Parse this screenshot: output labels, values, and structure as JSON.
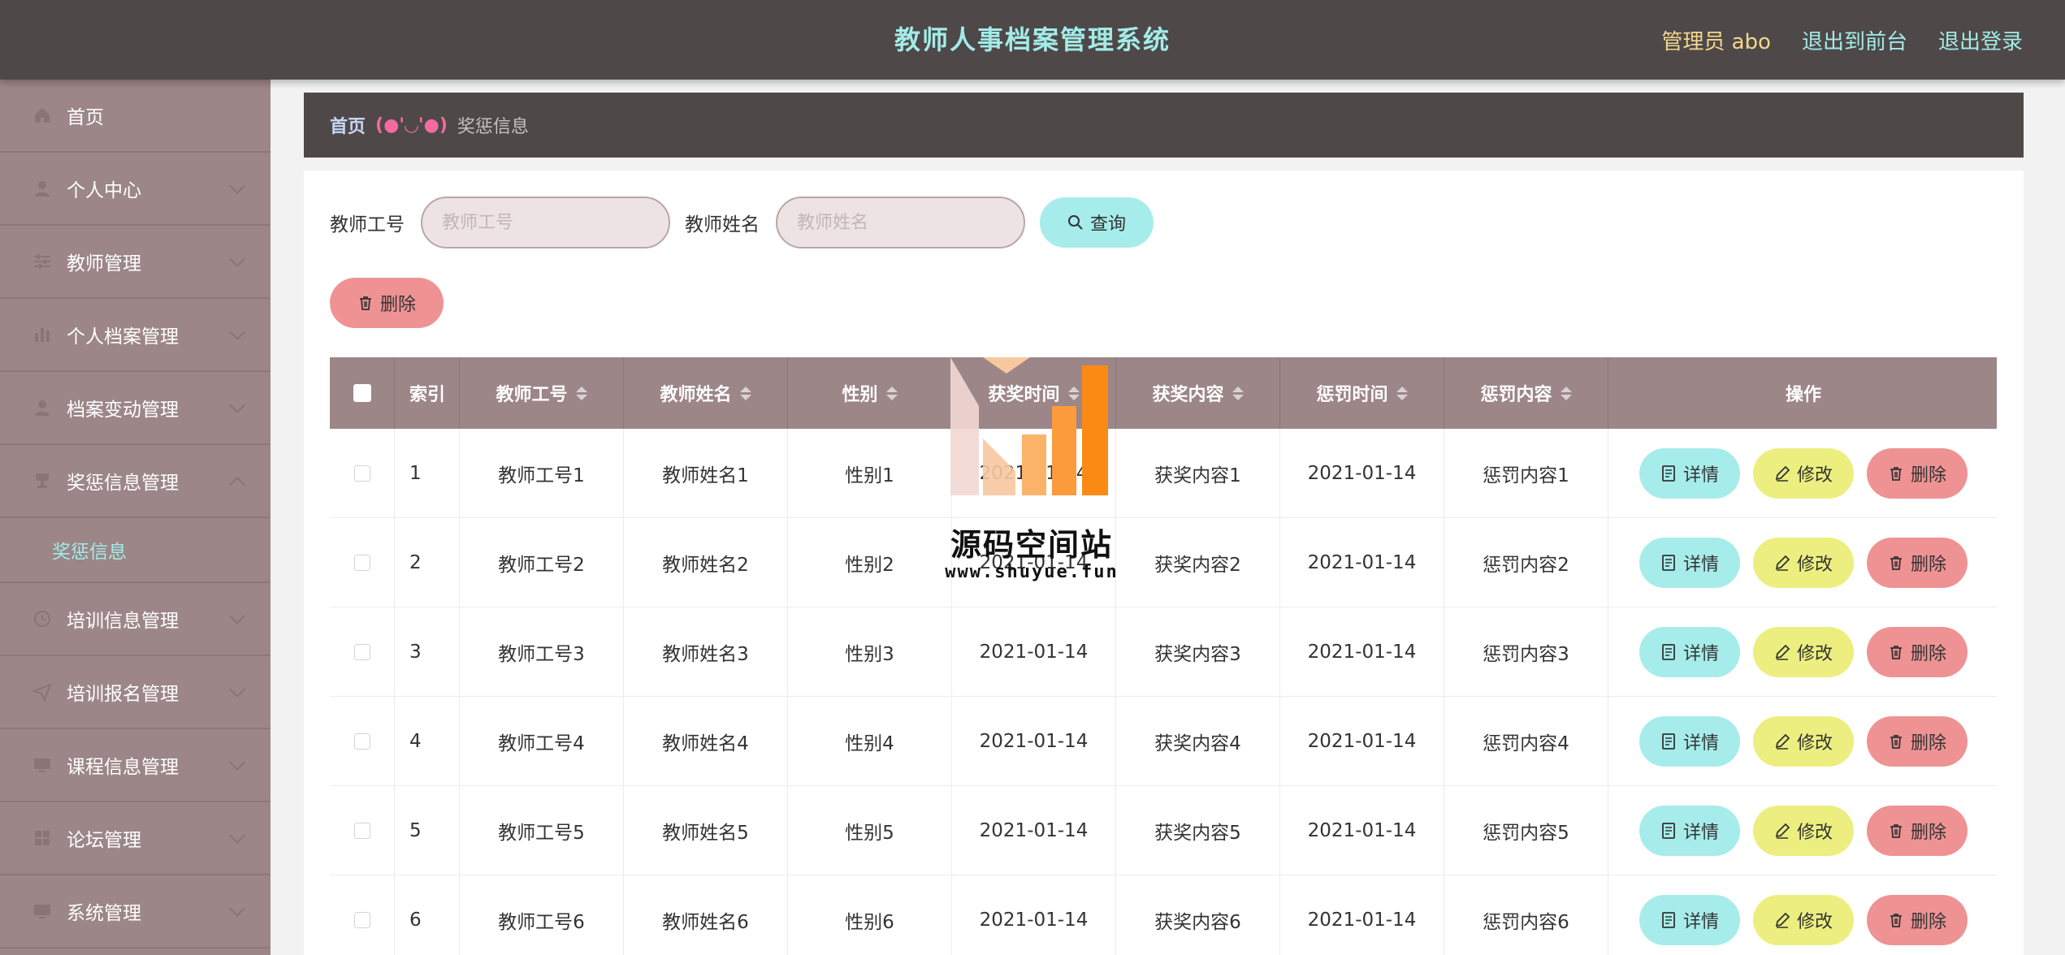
{
  "header": {
    "title": "教师人事档案管理系统",
    "admin_label": "管理员 abo",
    "front_link": "退出到前台",
    "logout_link": "退出登录"
  },
  "sidebar": {
    "items": [
      {
        "label": "首页",
        "icon": "home-icon"
      },
      {
        "label": "个人中心",
        "icon": "user-icon"
      },
      {
        "label": "教师管理",
        "icon": "sliders-icon"
      },
      {
        "label": "个人档案管理",
        "icon": "bar-chart-icon"
      },
      {
        "label": "档案变动管理",
        "icon": "user-icon"
      },
      {
        "label": "奖惩信息管理",
        "icon": "trophy-icon"
      },
      {
        "label": "培训信息管理",
        "icon": "clock-icon"
      },
      {
        "label": "培训报名管理",
        "icon": "send-icon"
      },
      {
        "label": "课程信息管理",
        "icon": "monitor-icon"
      },
      {
        "label": "论坛管理",
        "icon": "grid-icon"
      },
      {
        "label": "系统管理",
        "icon": "monitor-icon"
      }
    ],
    "sub_item": "奖惩信息"
  },
  "breadcrumb": {
    "home": "首页",
    "separator": "(●'◡'●)",
    "current": "奖惩信息"
  },
  "search": {
    "id_label": "教师工号",
    "id_placeholder": "教师工号",
    "name_label": "教师姓名",
    "name_placeholder": "教师姓名",
    "query_label": "查询"
  },
  "toolbar": {
    "delete_label": "删除"
  },
  "table": {
    "headers": [
      "索引",
      "教师工号",
      "教师姓名",
      "性别",
      "获奖时间",
      "获奖内容",
      "惩罚时间",
      "惩罚内容",
      "操作"
    ],
    "rows": [
      [
        "1",
        "教师工号1",
        "教师姓名1",
        "性别1",
        "2021-01-14",
        "获奖内容1",
        "2021-01-14",
        "惩罚内容1"
      ],
      [
        "2",
        "教师工号2",
        "教师姓名2",
        "性别2",
        "2021-01-14",
        "获奖内容2",
        "2021-01-14",
        "惩罚内容2"
      ],
      [
        "3",
        "教师工号3",
        "教师姓名3",
        "性别3",
        "2021-01-14",
        "获奖内容3",
        "2021-01-14",
        "惩罚内容3"
      ],
      [
        "4",
        "教师工号4",
        "教师姓名4",
        "性别4",
        "2021-01-14",
        "获奖内容4",
        "2021-01-14",
        "惩罚内容4"
      ],
      [
        "5",
        "教师工号5",
        "教师姓名5",
        "性别5",
        "2021-01-14",
        "获奖内容5",
        "2021-01-14",
        "惩罚内容5"
      ],
      [
        "6",
        "教师工号6",
        "教师姓名6",
        "性别6",
        "2021-01-14",
        "获奖内容6",
        "2021-01-14",
        "惩罚内容6"
      ]
    ],
    "actions": {
      "detail": "详情",
      "edit": "修改",
      "delete": "删除"
    }
  },
  "watermark": {
    "text": "源码空间站",
    "url": "www.shuyue.fun"
  },
  "colors": {
    "header_bg": "#4f4848",
    "sidebar_bg": "#9c8687",
    "accent_cyan": "#a6ecea",
    "accent_yellow": "#ecef7f",
    "accent_red": "#ef9293"
  }
}
